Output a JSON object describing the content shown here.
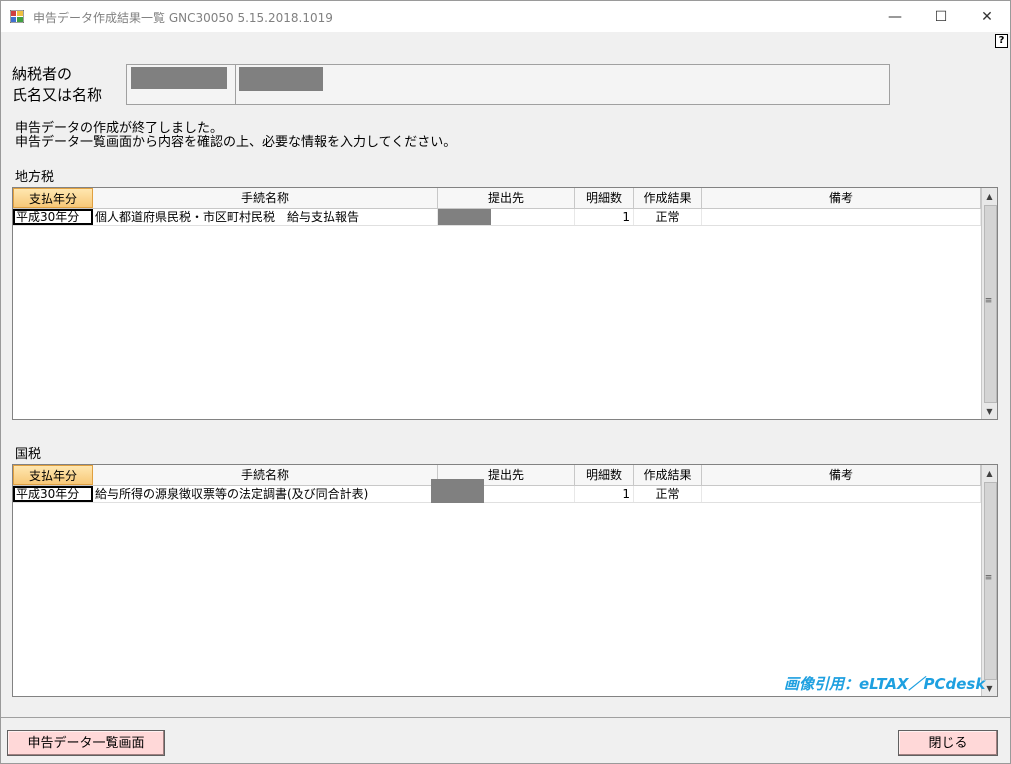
{
  "window": {
    "title": "申告データ作成結果一覧 GNC30050  5.15.2018.1019",
    "minimize": "—",
    "maximize": "☐",
    "close": "✕",
    "help": "?"
  },
  "taxpayer": {
    "label": "納税者の\n氏名又は名称"
  },
  "message": {
    "line1": "申告データの作成が終了しました。",
    "line2": "申告データ一覧画面から内容を確認の上、必要な情報を入力してください。"
  },
  "local_tax": {
    "section_label": "地方税",
    "columns": [
      "支払年分",
      "手続名称",
      "提出先",
      "明細数",
      "作成結果",
      "備考"
    ],
    "rows": [
      {
        "year": "平成30年分",
        "procedure": "個人都道府県民税・市区町村民税　給与支払報告",
        "destination": "",
        "count": "1",
        "result": "正常",
        "remarks": ""
      }
    ]
  },
  "national_tax": {
    "section_label": "国税",
    "columns": [
      "支払年分",
      "手続名称",
      "提出先",
      "明細数",
      "作成結果",
      "備考"
    ],
    "rows": [
      {
        "year": "平成30年分",
        "procedure": "給与所得の源泉徴収票等の法定調書(及び同合計表)",
        "destination": "",
        "count": "1",
        "result": "正常",
        "remarks": ""
      }
    ]
  },
  "watermark": "画像引用：eLTAX／PCdesk",
  "buttons": {
    "list_screen": "申告データ一覧画面",
    "close": "閉じる"
  },
  "colors": {
    "header_highlight": "#f7c878",
    "button_bg": "#ffd8d8",
    "watermark": "#1ea0e0"
  }
}
